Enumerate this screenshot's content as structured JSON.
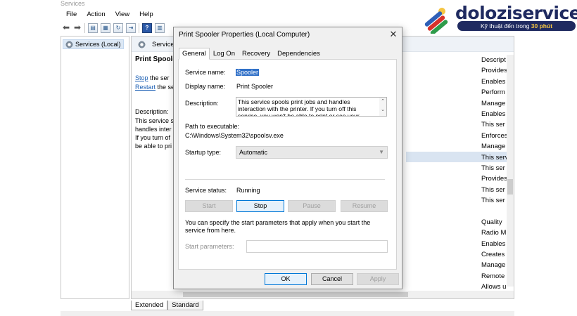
{
  "window": {
    "title": "Services",
    "menu": [
      "File",
      "Action",
      "View",
      "Help"
    ],
    "left_pane_item": "Services (Local)",
    "header_label": "Service",
    "selected_service": {
      "title": "Print Spoole",
      "stop_link": "Stop",
      "stop_rest": " the ser",
      "restart_link": "Restart",
      "restart_rest": " the se",
      "description_label": "Description:",
      "description_lines": [
        "This service s",
        "handles inter",
        "If you turn of",
        "be able to pri"
      ]
    },
    "description_column": {
      "header": "Descript",
      "items": [
        "Provides",
        "Enables",
        "Perform",
        "Manage",
        "Enables",
        "This ser",
        "Enforces",
        "Manage",
        "This serv",
        "This ser",
        "Provides",
        "This ser",
        "This ser",
        "",
        "Quality",
        "Radio M",
        "Enables",
        "Creates",
        "Manage",
        "Remote",
        "Allows u"
      ]
    },
    "bottom_tabs": [
      "Extended",
      "Standard"
    ]
  },
  "dialog": {
    "title": "Print Spooler Properties (Local Computer)",
    "close_glyph": "✕",
    "tabs": [
      "General",
      "Log On",
      "Recovery",
      "Dependencies"
    ],
    "service_name_label": "Service name:",
    "service_name": "Spooler",
    "display_name_label": "Display name:",
    "display_name": "Print Spooler",
    "description_label": "Description:",
    "description": "This service spools print jobs and handles interaction with the printer.  If you turn off this service, you won't be able to print or see your printers.",
    "path_label": "Path to executable:",
    "path": "C:\\Windows\\System32\\spoolsv.exe",
    "startup_label": "Startup type:",
    "startup_value": "Automatic",
    "status_label": "Service status:",
    "status_value": "Running",
    "buttons": {
      "start": "Start",
      "stop": "Stop",
      "pause": "Pause",
      "resume": "Resume"
    },
    "params_hint": "You can specify the start parameters that apply when you start the service from here.",
    "params_label": "Start parameters:",
    "params_value": "",
    "footer": {
      "ok": "OK",
      "cancel": "Cancel",
      "apply": "Apply"
    }
  },
  "brand": {
    "name": "doloziservice",
    "tagline_prefix": "Kỹ thuật đến trong ",
    "tagline_highlight": "30 phút",
    "colors": {
      "navy": "#1f2a60",
      "yellow": "#f5c542",
      "green": "#2e9b4a",
      "red": "#d8322b",
      "blue": "#2e5fb7"
    }
  }
}
